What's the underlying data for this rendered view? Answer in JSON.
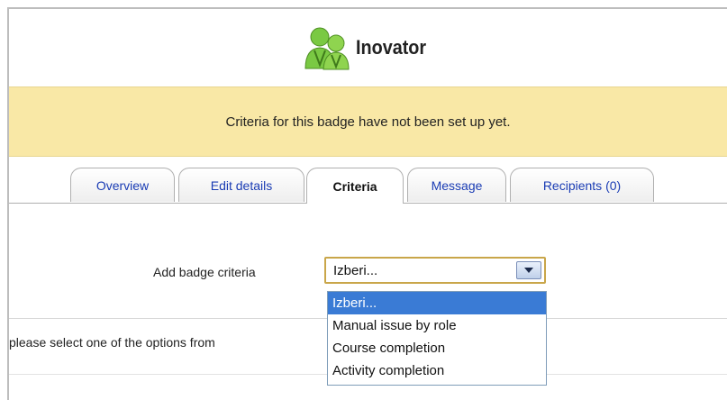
{
  "header": {
    "title": "Inovator",
    "icon": "users-badge-icon"
  },
  "notice": {
    "text": "Criteria for this badge have not been set up yet."
  },
  "tabs": [
    {
      "label": "Overview",
      "active": false
    },
    {
      "label": "Edit details",
      "active": false
    },
    {
      "label": "Criteria",
      "active": true
    },
    {
      "label": "Message",
      "active": false
    },
    {
      "label": "Recipients (0)",
      "active": false
    }
  ],
  "form": {
    "label": "Add badge criteria",
    "select_value": "Izberi...",
    "options": [
      "Izberi...",
      "Manual issue by role",
      "Course completion",
      "Activity completion"
    ],
    "helper_text": "please select one of the options from"
  },
  "colors": {
    "notice_bg": "#f9e8a6",
    "link": "#1a3cb4",
    "selected_option": "#3a7bd5",
    "select_border": "#c9a64a"
  }
}
